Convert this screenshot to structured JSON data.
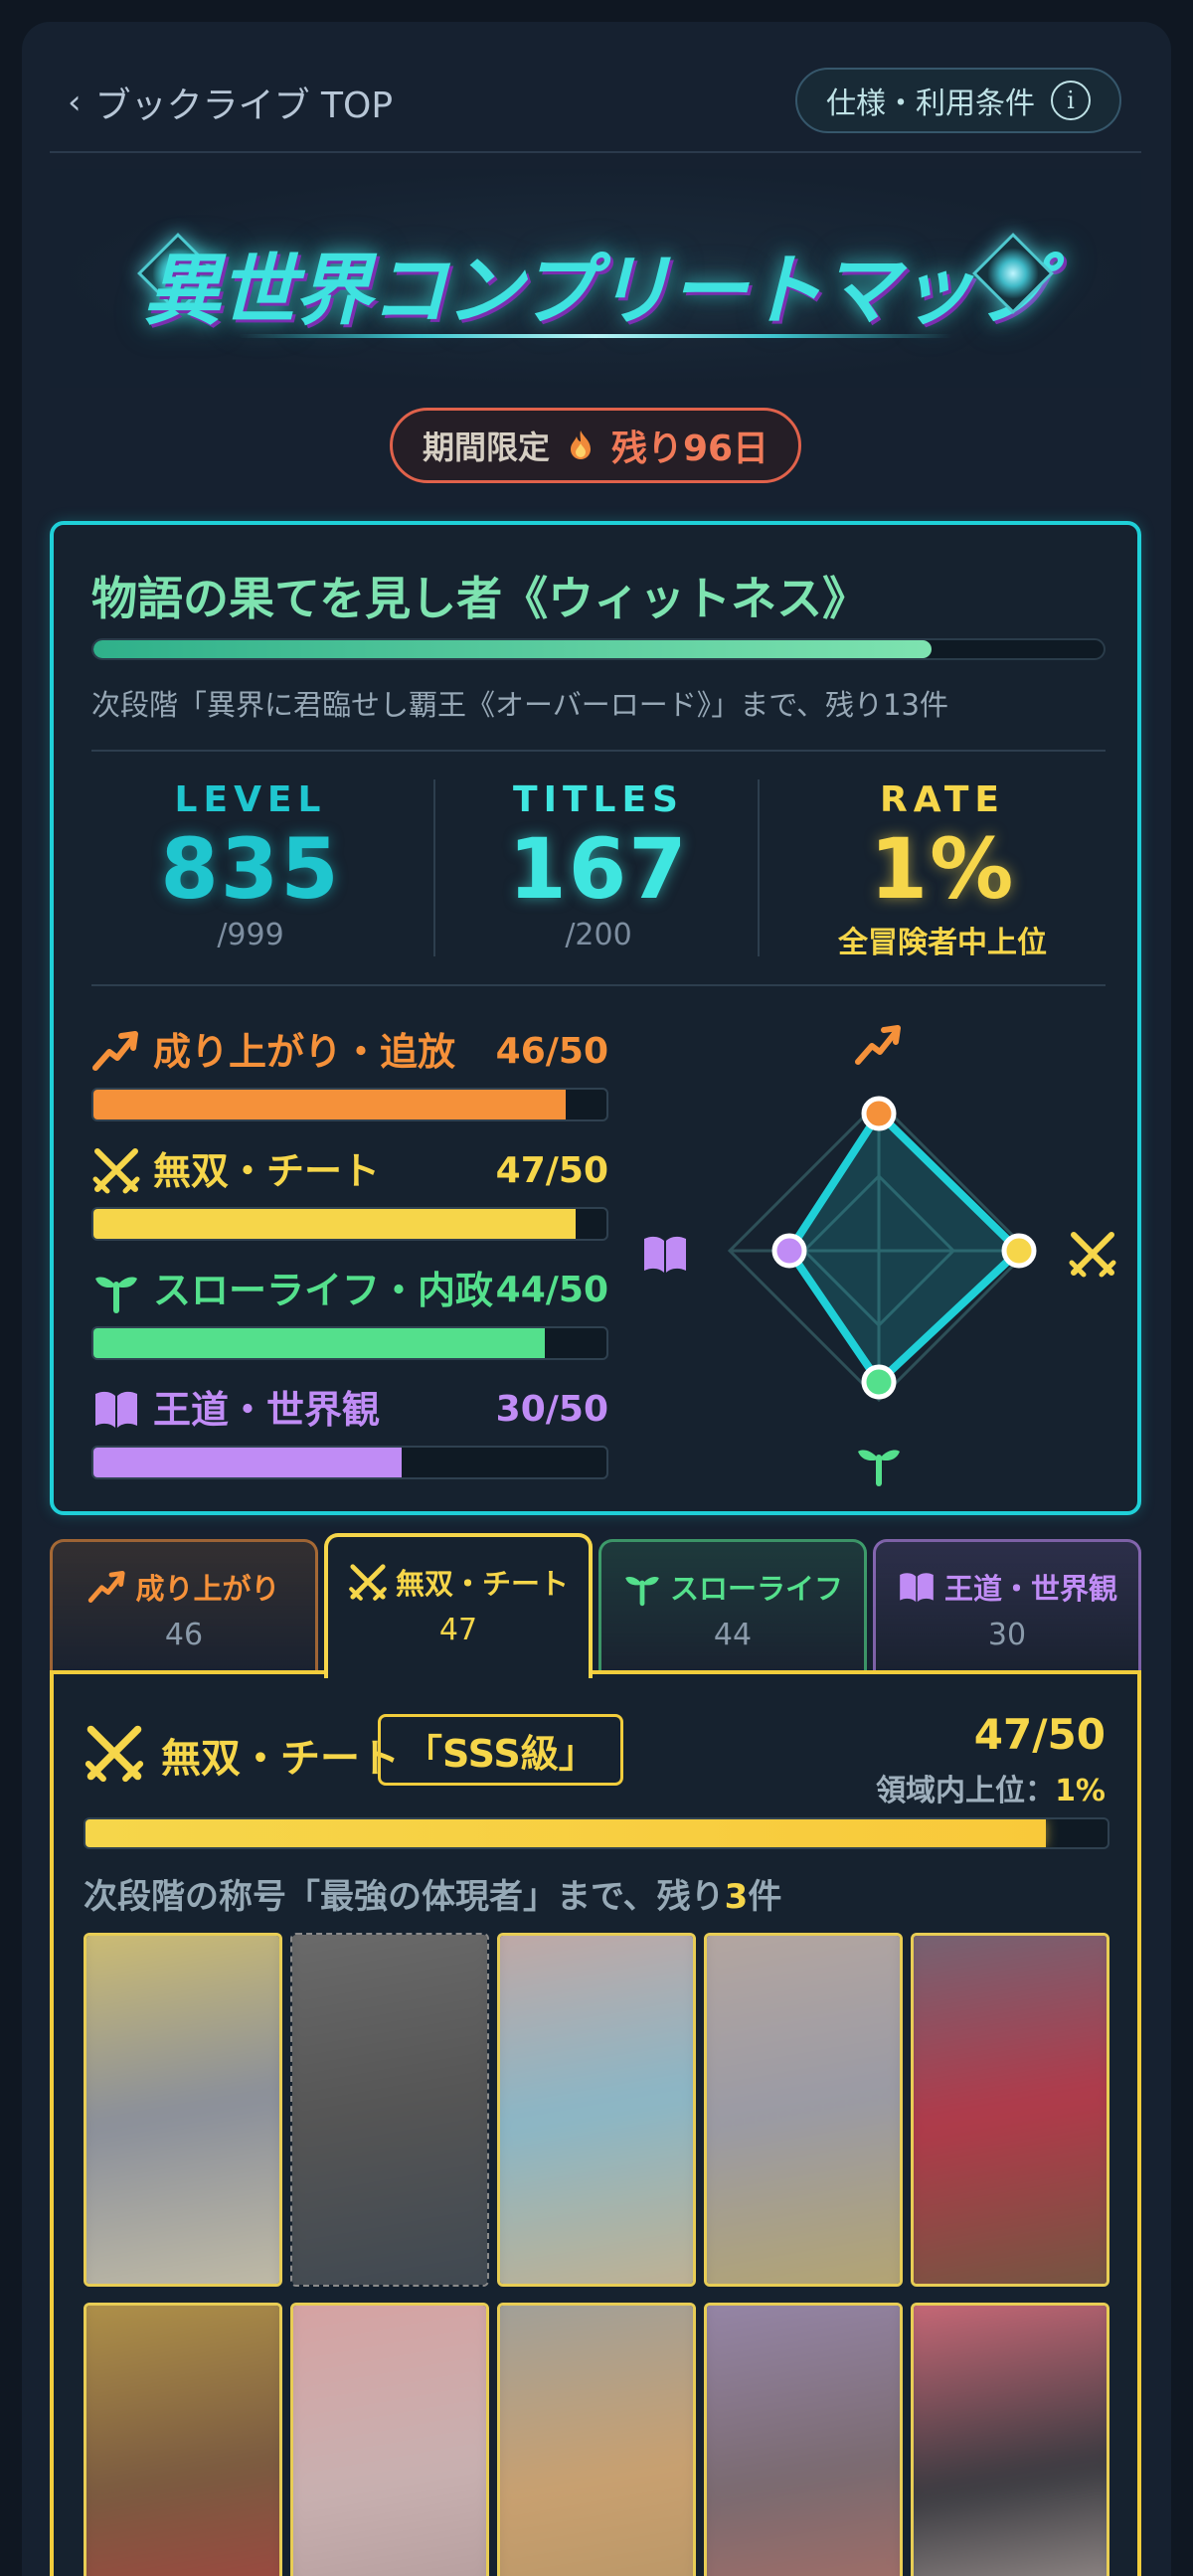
{
  "header": {
    "back_label": "ブックライブ TOP",
    "terms_label": "仕様・利用条件",
    "info_icon_glyph": "i"
  },
  "banner": {
    "logo_text": "異世界コンプリートマップ",
    "limited_label": "期間限定",
    "remaining_label": "残り96日"
  },
  "profile": {
    "rank_title": "物語の果てを見し者《ウィットネス》",
    "rank_progress": 0.83,
    "next_rank_text": "次段階「異界に君臨せし覇王《オーバーロード》」まで、残り13件",
    "stats": {
      "level": {
        "label": "LEVEL",
        "value": "835",
        "sub": "/999",
        "color": "#1fc6cf"
      },
      "titles": {
        "label": "TITLES",
        "value": "167",
        "sub": "/200",
        "color": "#3fe6e0"
      },
      "rate": {
        "label": "RATE",
        "value": "1%",
        "sub": "全冒険者中上位",
        "color": "#f6d64a"
      }
    },
    "categories": [
      {
        "name": "成り上がり・追放",
        "score": "46/50",
        "value": 46,
        "max": 50,
        "color": "#f5913a",
        "icon": "trending-up-icon"
      },
      {
        "name": "無双・チート",
        "score": "47/50",
        "value": 47,
        "max": 50,
        "color": "#f6d64a",
        "icon": "crossed-swords-icon"
      },
      {
        "name": "スローライフ・内政",
        "score": "44/50",
        "value": 44,
        "max": 50,
        "color": "#54e08c",
        "icon": "sprout-icon"
      },
      {
        "name": "王道・世界観",
        "score": "30/50",
        "value": 30,
        "max": 50,
        "color": "#c08cf5",
        "icon": "open-book-icon"
      }
    ]
  },
  "tabs": [
    {
      "label": "成り上がり",
      "count": "46",
      "color": "#f5913a",
      "icon": "trending-up-icon"
    },
    {
      "label": "無双・チート",
      "count": "47",
      "color": "#f6d64a",
      "icon": "crossed-swords-icon",
      "active": true
    },
    {
      "label": "スローライフ",
      "count": "44",
      "color": "#54e08c",
      "icon": "sprout-icon"
    },
    {
      "label": "王道・世界観",
      "count": "30",
      "color": "#c08cf5",
      "icon": "open-book-icon"
    }
  ],
  "detail": {
    "name": "無双・チート",
    "grade": "「SSS級」",
    "score": "47/50",
    "progress": 0.94,
    "rank_label": "領域内上位：",
    "rank_value": "1%",
    "next_prefix": "次段階の称号「最強の体現者」まで、残り",
    "next_count": "3",
    "next_suffix": "件",
    "books": [
      {
        "colors": [
          "#d8c46c",
          "#8a8f9a",
          "#c9c2a8"
        ],
        "empty": false
      },
      {
        "colors": [
          "#6e6e6e",
          "#555",
          "#3c4650"
        ],
        "empty": true
      },
      {
        "colors": [
          "#c9a6a0",
          "#8ab6c6",
          "#c8b08a"
        ],
        "empty": false
      },
      {
        "colors": [
          "#b8a8a0",
          "#9a9aa4",
          "#b8a66a"
        ],
        "empty": false
      },
      {
        "colors": [
          "#6a6a7a",
          "#b03a4a",
          "#6a5a40"
        ],
        "empty": false
      },
      {
        "colors": [
          "#b89a4a",
          "#7a5a40",
          "#b83a40"
        ],
        "empty": false
      },
      {
        "colors": [
          "#d8a0a0",
          "#c8b0b0",
          "#a89090"
        ],
        "empty": false
      },
      {
        "colors": [
          "#9aa0a0",
          "#c8a070",
          "#b09060"
        ],
        "empty": false
      },
      {
        "colors": [
          "#9a8ab0",
          "#7a6a70",
          "#c07060"
        ],
        "empty": false
      },
      {
        "colors": [
          "#e07080",
          "#3a3a40",
          "#d8c8c0"
        ],
        "empty": false
      }
    ]
  }
}
